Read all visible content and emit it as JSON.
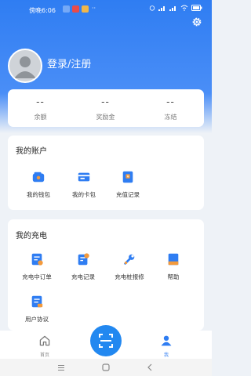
{
  "status_bar": {
    "time": "傍晚6:06",
    "extra": "··"
  },
  "profile": {
    "login_label": "登录/注册"
  },
  "stats": [
    {
      "value": "--",
      "label": "余额"
    },
    {
      "value": "--",
      "label": "奖励金"
    },
    {
      "value": "--",
      "label": "冻结"
    }
  ],
  "account": {
    "title": "我的账户",
    "items": [
      {
        "label": "我的钱包",
        "icon": "wallet-icon"
      },
      {
        "label": "我的卡包",
        "icon": "card-icon"
      },
      {
        "label": "充值记录",
        "icon": "recharge-record-icon"
      }
    ]
  },
  "charging": {
    "title": "我的充电",
    "items": [
      {
        "label": "充电中订单",
        "icon": "order-icon"
      },
      {
        "label": "充电记录",
        "icon": "charge-record-icon"
      },
      {
        "label": "充电桩报修",
        "icon": "wrench-icon"
      },
      {
        "label": "帮助",
        "icon": "help-book-icon"
      },
      {
        "label": "用户协议",
        "icon": "agreement-icon"
      }
    ]
  },
  "tabbar": {
    "home_label": "首页",
    "me_label": "我"
  },
  "colors": {
    "primary": "#2f7df2",
    "accent": "#2288f0",
    "orange": "#f39a3c"
  }
}
